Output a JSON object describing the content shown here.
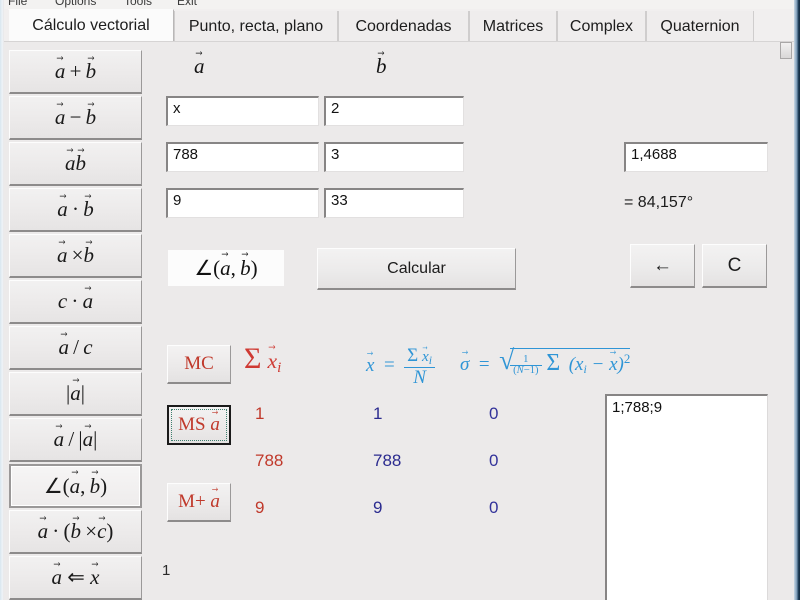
{
  "window": {
    "menubar": [
      "File",
      "Options",
      "Tools",
      "Exit"
    ]
  },
  "tabs": [
    {
      "label": "Cálculo vectorial",
      "active": true
    },
    {
      "label": "Punto, recta, plano",
      "active": false
    },
    {
      "label": "Coordenadas",
      "active": false
    },
    {
      "label": "Matrices",
      "active": false
    },
    {
      "label": "Complex",
      "active": false
    },
    {
      "label": "Quaternion",
      "active": false
    }
  ],
  "sidebar": {
    "items": [
      {
        "name": "op-add",
        "label": "a + b",
        "selected": false
      },
      {
        "name": "op-subtract",
        "label": "a − b",
        "selected": false
      },
      {
        "name": "op-ab",
        "label": "ab",
        "selected": false
      },
      {
        "name": "op-dot",
        "label": "a · b",
        "selected": false
      },
      {
        "name": "op-cross",
        "label": "a × b",
        "selected": false
      },
      {
        "name": "op-scalar-times",
        "label": "c · a",
        "selected": false
      },
      {
        "name": "op-scalar-divide",
        "label": "a / c",
        "selected": false
      },
      {
        "name": "op-magnitude",
        "label": "|a|",
        "selected": false
      },
      {
        "name": "op-normalize",
        "label": "a / |a|",
        "selected": false
      },
      {
        "name": "op-angle",
        "label": "∠(a, b)",
        "selected": true
      },
      {
        "name": "op-triple",
        "label": "a · (b × c)",
        "selected": false
      },
      {
        "name": "op-solve",
        "label": "a ⇐ x",
        "selected": false
      }
    ]
  },
  "vectors": {
    "a": {
      "label": "a",
      "components": [
        "x",
        "788",
        "9"
      ]
    },
    "b": {
      "label": "b",
      "components": [
        "2",
        "3",
        "33"
      ]
    }
  },
  "operation": {
    "display": "∠(a, b)",
    "calculate_label": "Calcular"
  },
  "result": {
    "value": "1,4688",
    "degrees": "= 84,157°"
  },
  "edit_buttons": {
    "backspace_label": "←",
    "clear_label": "C"
  },
  "memory": {
    "buttons": [
      {
        "name": "memory-clear-button",
        "label": "MC",
        "focused": false
      },
      {
        "name": "memory-store-button",
        "label": "MS a",
        "focused": true
      },
      {
        "name": "memory-add-button",
        "label": "M+ a",
        "focused": false
      }
    ]
  },
  "statistics": {
    "sum_header": "Σ x⃗ᵢ",
    "mean_header": "x̄ = Σ x⃗ᵢ / N",
    "sigma_header": "σ⃗ = √( 1/(N−1) Σ (xᵢ − x̄)² )",
    "sum_values": [
      "1",
      "788",
      "9"
    ],
    "mean_values": [
      "1",
      "788",
      "9"
    ],
    "sigma_values": [
      "0",
      "0",
      "0"
    ]
  },
  "memory_list": {
    "entries": [
      "1;788;9"
    ]
  },
  "counter": "1",
  "colors": {
    "sum_red": "#c0392b",
    "mean_navy": "#2b2b8f",
    "formula_red": "#cf3a33",
    "formula_blue": "#2f95d6",
    "window_border": "#1b3b56"
  }
}
